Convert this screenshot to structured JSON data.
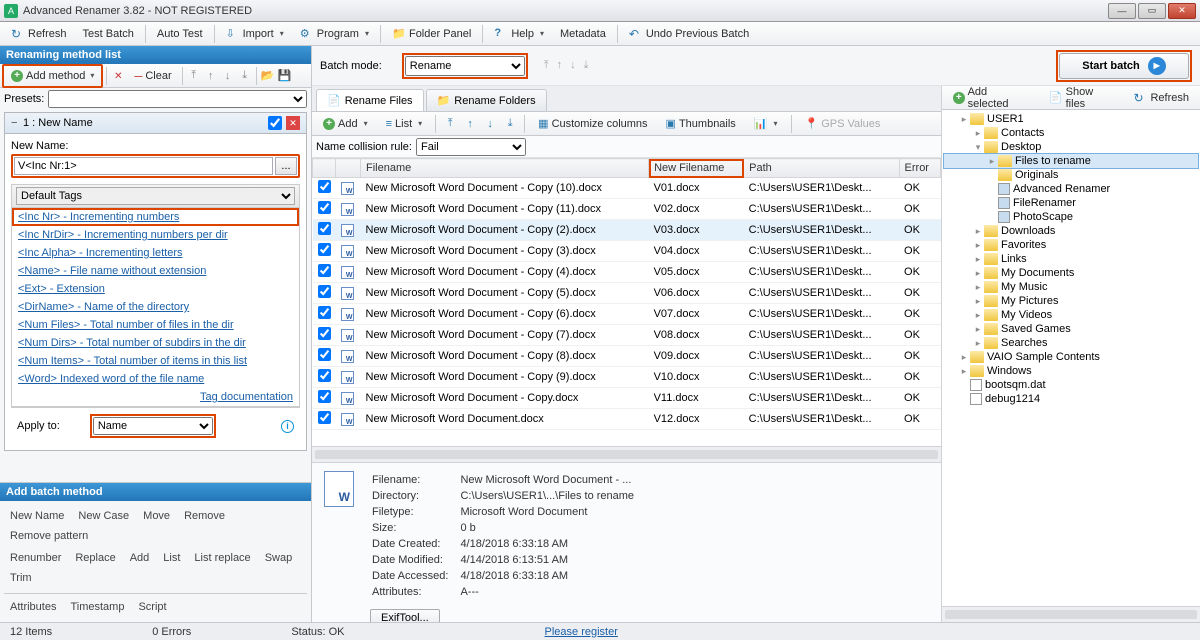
{
  "window": {
    "title": "Advanced Renamer 3.82 - NOT REGISTERED"
  },
  "toolbar": {
    "refresh": "Refresh",
    "test_batch": "Test Batch",
    "auto_test": "Auto Test",
    "import": "Import",
    "program": "Program",
    "folder_panel": "Folder Panel",
    "help": "Help",
    "metadata": "Metadata",
    "undo": "Undo Previous Batch"
  },
  "left": {
    "header": "Renaming method list",
    "add_method": "Add method",
    "clear": "Clear",
    "presets_label": "Presets:",
    "method_title": "1 : New Name",
    "new_name_label": "New Name:",
    "new_name_value": "V<Inc Nr:1>",
    "default_tags": "Default Tags",
    "tags": [
      "<Inc Nr> - Incrementing numbers",
      "<Inc NrDir> - Incrementing numbers per dir",
      "<Inc Alpha> - Incrementing letters",
      "<Name> - File name without extension",
      "<Ext> - Extension",
      "<DirName> - Name of the directory",
      "<Num Files> - Total number of files in the dir",
      "<Num Dirs> - Total number of subdirs in the dir",
      "<Num Items> - Total number of items in this list",
      "<Word> Indexed word of the file name"
    ],
    "tag_doc": "Tag documentation",
    "apply_to_label": "Apply to:",
    "apply_to_value": "Name",
    "batch_header": "Add batch method",
    "batch_methods": [
      "New Name",
      "New Case",
      "Move",
      "Remove",
      "Remove pattern",
      "Renumber",
      "Replace",
      "Add",
      "List",
      "List replace",
      "Swap",
      "Trim",
      "Attributes",
      "Timestamp",
      "Script"
    ]
  },
  "top": {
    "batch_mode_label": "Batch mode:",
    "batch_mode_value": "Rename",
    "start_batch": "Start batch"
  },
  "filebar": {
    "tab_files": "Rename Files",
    "tab_folders": "Rename Folders",
    "add": "Add",
    "list": "List",
    "customize": "Customize columns",
    "thumbnails": "Thumbnails",
    "gps": "GPS Values",
    "collision_label": "Name collision rule:",
    "collision_value": "Fail"
  },
  "grid": {
    "cols": [
      "Filename",
      "New Filename",
      "Path",
      "Error"
    ],
    "rows": [
      {
        "fn": "New Microsoft Word Document - Copy (10).docx",
        "nf": "V01.docx",
        "p": "C:\\Users\\USER1\\Deskt...",
        "e": "OK"
      },
      {
        "fn": "New Microsoft Word Document - Copy (11).docx",
        "nf": "V02.docx",
        "p": "C:\\Users\\USER1\\Deskt...",
        "e": "OK"
      },
      {
        "fn": "New Microsoft Word Document - Copy (2).docx",
        "nf": "V03.docx",
        "p": "C:\\Users\\USER1\\Deskt...",
        "e": "OK",
        "sel": true
      },
      {
        "fn": "New Microsoft Word Document - Copy (3).docx",
        "nf": "V04.docx",
        "p": "C:\\Users\\USER1\\Deskt...",
        "e": "OK"
      },
      {
        "fn": "New Microsoft Word Document - Copy (4).docx",
        "nf": "V05.docx",
        "p": "C:\\Users\\USER1\\Deskt...",
        "e": "OK"
      },
      {
        "fn": "New Microsoft Word Document - Copy (5).docx",
        "nf": "V06.docx",
        "p": "C:\\Users\\USER1\\Deskt...",
        "e": "OK"
      },
      {
        "fn": "New Microsoft Word Document - Copy (6).docx",
        "nf": "V07.docx",
        "p": "C:\\Users\\USER1\\Deskt...",
        "e": "OK"
      },
      {
        "fn": "New Microsoft Word Document - Copy (7).docx",
        "nf": "V08.docx",
        "p": "C:\\Users\\USER1\\Deskt...",
        "e": "OK"
      },
      {
        "fn": "New Microsoft Word Document - Copy (8).docx",
        "nf": "V09.docx",
        "p": "C:\\Users\\USER1\\Deskt...",
        "e": "OK"
      },
      {
        "fn": "New Microsoft Word Document - Copy (9).docx",
        "nf": "V10.docx",
        "p": "C:\\Users\\USER1\\Deskt...",
        "e": "OK"
      },
      {
        "fn": "New Microsoft Word Document - Copy.docx",
        "nf": "V11.docx",
        "p": "C:\\Users\\USER1\\Deskt...",
        "e": "OK"
      },
      {
        "fn": "New Microsoft Word Document.docx",
        "nf": "V12.docx",
        "p": "C:\\Users\\USER1\\Deskt...",
        "e": "OK"
      }
    ]
  },
  "treebar": {
    "add_selected": "Add selected",
    "show_files": "Show files",
    "refresh": "Refresh"
  },
  "tree": [
    {
      "ind": 1,
      "exp": "▸",
      "label": "USER1"
    },
    {
      "ind": 2,
      "exp": "▸",
      "label": "Contacts"
    },
    {
      "ind": 2,
      "exp": "▾",
      "label": "Desktop"
    },
    {
      "ind": 3,
      "exp": "▸",
      "label": "Files to rename",
      "sel": true
    },
    {
      "ind": 3,
      "exp": "",
      "label": "Originals"
    },
    {
      "ind": 3,
      "exp": "",
      "label": "Advanced Renamer",
      "ico": "app"
    },
    {
      "ind": 3,
      "exp": "",
      "label": "FileRenamer",
      "ico": "app"
    },
    {
      "ind": 3,
      "exp": "",
      "label": "PhotoScape",
      "ico": "app"
    },
    {
      "ind": 2,
      "exp": "▸",
      "label": "Downloads"
    },
    {
      "ind": 2,
      "exp": "▸",
      "label": "Favorites"
    },
    {
      "ind": 2,
      "exp": "▸",
      "label": "Links"
    },
    {
      "ind": 2,
      "exp": "▸",
      "label": "My Documents"
    },
    {
      "ind": 2,
      "exp": "▸",
      "label": "My Music"
    },
    {
      "ind": 2,
      "exp": "▸",
      "label": "My Pictures"
    },
    {
      "ind": 2,
      "exp": "▸",
      "label": "My Videos"
    },
    {
      "ind": 2,
      "exp": "▸",
      "label": "Saved Games"
    },
    {
      "ind": 2,
      "exp": "▸",
      "label": "Searches"
    },
    {
      "ind": 1,
      "exp": "▸",
      "label": "VAIO Sample Contents"
    },
    {
      "ind": 1,
      "exp": "▸",
      "label": "Windows"
    },
    {
      "ind": 1,
      "exp": "",
      "label": "bootsqm.dat",
      "ico": "file"
    },
    {
      "ind": 1,
      "exp": "",
      "label": "debug1214",
      "ico": "file"
    }
  ],
  "details": {
    "rows": [
      [
        "Filename:",
        "New Microsoft Word Document - ..."
      ],
      [
        "Directory:",
        "C:\\Users\\USER1\\...\\Files to rename"
      ],
      [
        "Filetype:",
        "Microsoft Word Document"
      ],
      [
        "Size:",
        "0 b"
      ],
      [
        "Date Created:",
        "4/18/2018 6:33:18 AM"
      ],
      [
        "Date Modified:",
        "4/14/2018 6:13:51 AM"
      ],
      [
        "Date Accessed:",
        "4/18/2018 6:33:18 AM"
      ],
      [
        "Attributes:",
        "A---"
      ]
    ],
    "exif": "ExifTool..."
  },
  "status": {
    "items": "12 Items",
    "errors": "0 Errors",
    "status": "Status: OK",
    "register": "Please register"
  }
}
